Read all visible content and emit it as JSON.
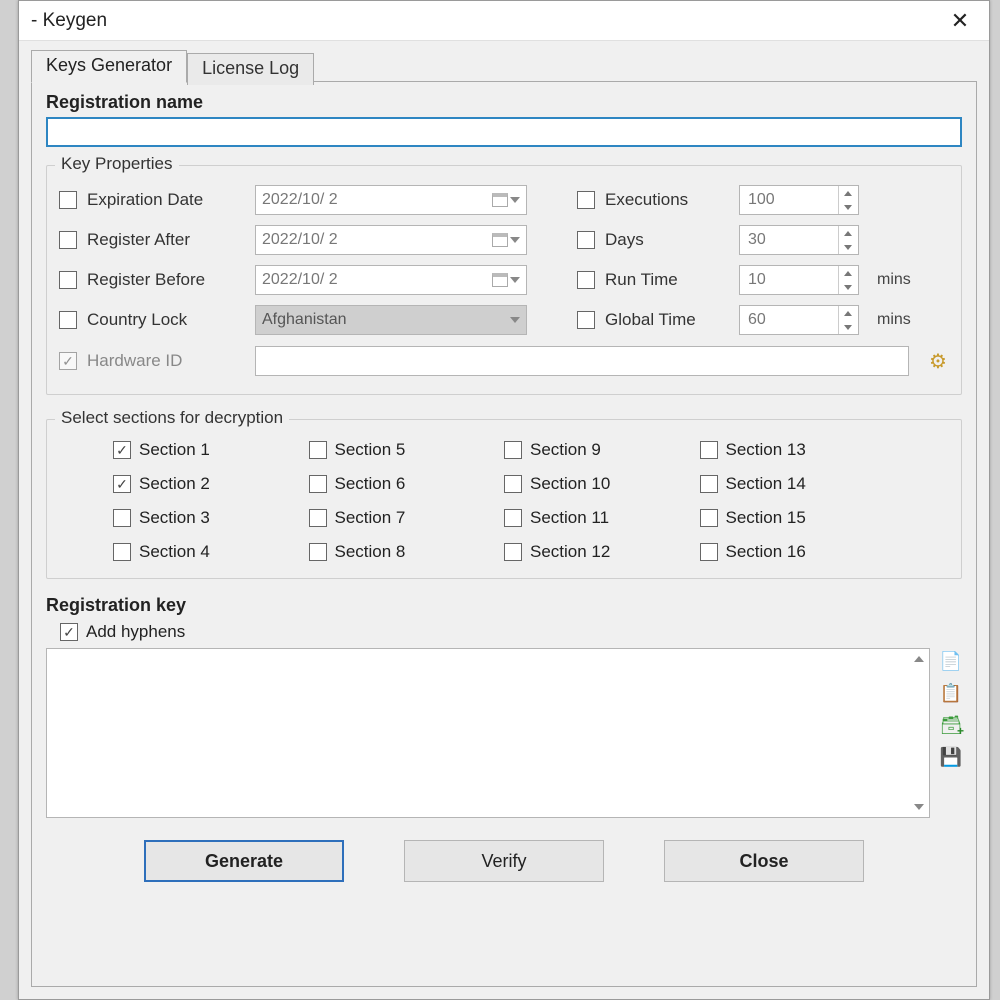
{
  "window": {
    "title": "- Keygen"
  },
  "tabs": {
    "keys_generator": "Keys Generator",
    "license_log": "License Log"
  },
  "registration_name": {
    "label": "Registration name",
    "value": ""
  },
  "key_properties": {
    "title": "Key Properties",
    "expiration_date": {
      "label": "Expiration Date",
      "value": "2022/10/ 2"
    },
    "register_after": {
      "label": "Register After",
      "value": "2022/10/ 2"
    },
    "register_before": {
      "label": "Register Before",
      "value": "2022/10/ 2"
    },
    "country_lock": {
      "label": "Country Lock",
      "value": "Afghanistan"
    },
    "hardware_id": {
      "label": "Hardware ID",
      "value": ""
    },
    "executions": {
      "label": "Executions",
      "value": "100"
    },
    "days": {
      "label": "Days",
      "value": "30"
    },
    "run_time": {
      "label": "Run Time",
      "value": "10",
      "unit": "mins"
    },
    "global_time": {
      "label": "Global Time",
      "value": "60",
      "unit": "mins"
    }
  },
  "sections": {
    "title": "Select sections for decryption",
    "items": [
      {
        "label": "Section 1",
        "checked": true
      },
      {
        "label": "Section 2",
        "checked": true
      },
      {
        "label": "Section 3",
        "checked": false
      },
      {
        "label": "Section 4",
        "checked": false
      },
      {
        "label": "Section 5",
        "checked": false
      },
      {
        "label": "Section 6",
        "checked": false
      },
      {
        "label": "Section 7",
        "checked": false
      },
      {
        "label": "Section 8",
        "checked": false
      },
      {
        "label": "Section 9",
        "checked": false
      },
      {
        "label": "Section 10",
        "checked": false
      },
      {
        "label": "Section 11",
        "checked": false
      },
      {
        "label": "Section 12",
        "checked": false
      },
      {
        "label": "Section 13",
        "checked": false
      },
      {
        "label": "Section 14",
        "checked": false
      },
      {
        "label": "Section 15",
        "checked": false
      },
      {
        "label": "Section 16",
        "checked": false
      }
    ]
  },
  "registration_key": {
    "title": "Registration key",
    "add_hyphens": "Add hyphens",
    "value": ""
  },
  "buttons": {
    "generate": "Generate",
    "verify": "Verify",
    "close": "Close"
  }
}
